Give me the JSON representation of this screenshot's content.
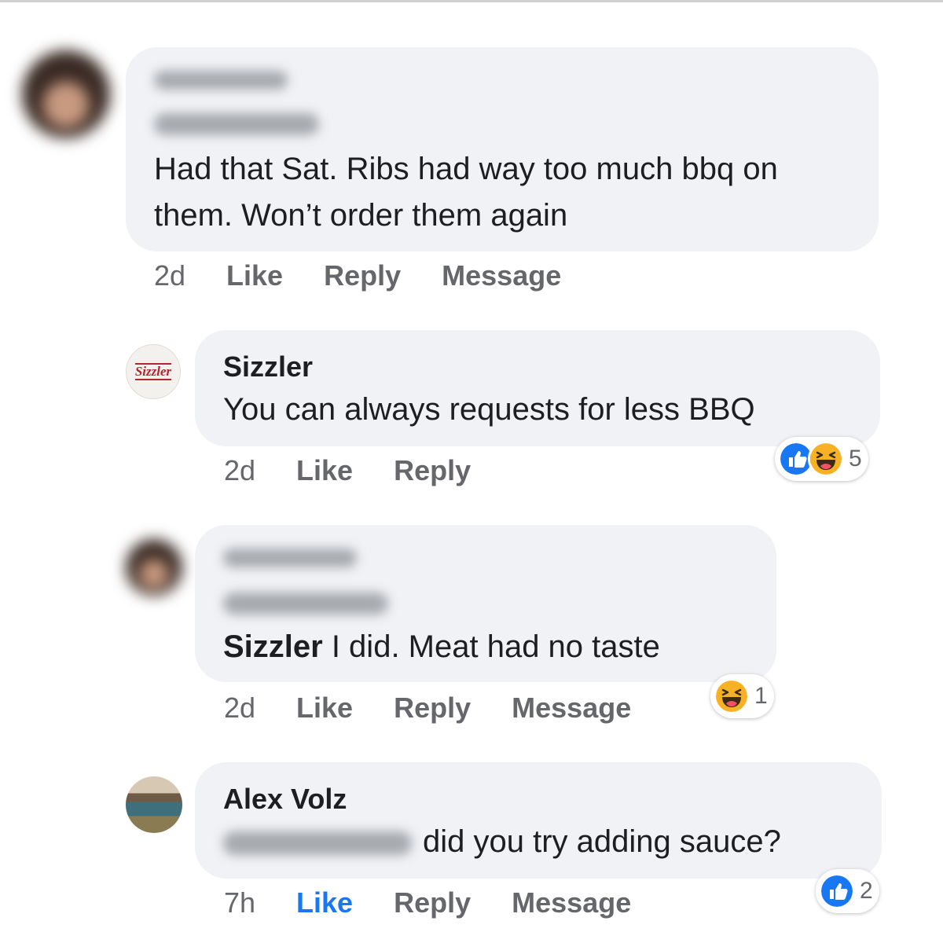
{
  "comments": [
    {
      "author": "",
      "text": "Had that Sat. Ribs had way too much bbq on them. Won’t order them again",
      "time": "2d",
      "like_label": "Like",
      "reply_label": "Reply",
      "message_label": "Message"
    },
    {
      "author": "Sizzler",
      "avatar_logo": "Sizzler",
      "text": "You can always requests for less BBQ",
      "time": "2d",
      "like_label": "Like",
      "reply_label": "Reply",
      "reactions": {
        "icons": [
          "like-icon",
          "haha-icon"
        ],
        "count": "5"
      }
    },
    {
      "author": "",
      "mention": "Sizzler",
      "text": " I did. Meat had no taste",
      "time": "2d",
      "like_label": "Like",
      "reply_label": "Reply",
      "message_label": "Message",
      "reactions": {
        "icons": [
          "haha-icon"
        ],
        "count": "1"
      }
    },
    {
      "author": "Alex Volz",
      "text": "did you try adding sauce?",
      "time": "7h",
      "like_label": "Like",
      "like_active": true,
      "reply_label": "Reply",
      "message_label": "Message",
      "reactions": {
        "icons": [
          "like-icon"
        ],
        "count": "2"
      }
    }
  ],
  "colors": {
    "bubble": "#f0f2f5",
    "action_text": "#65676b",
    "like_active": "#1877f2",
    "haha_yellow": "#f7b125"
  }
}
